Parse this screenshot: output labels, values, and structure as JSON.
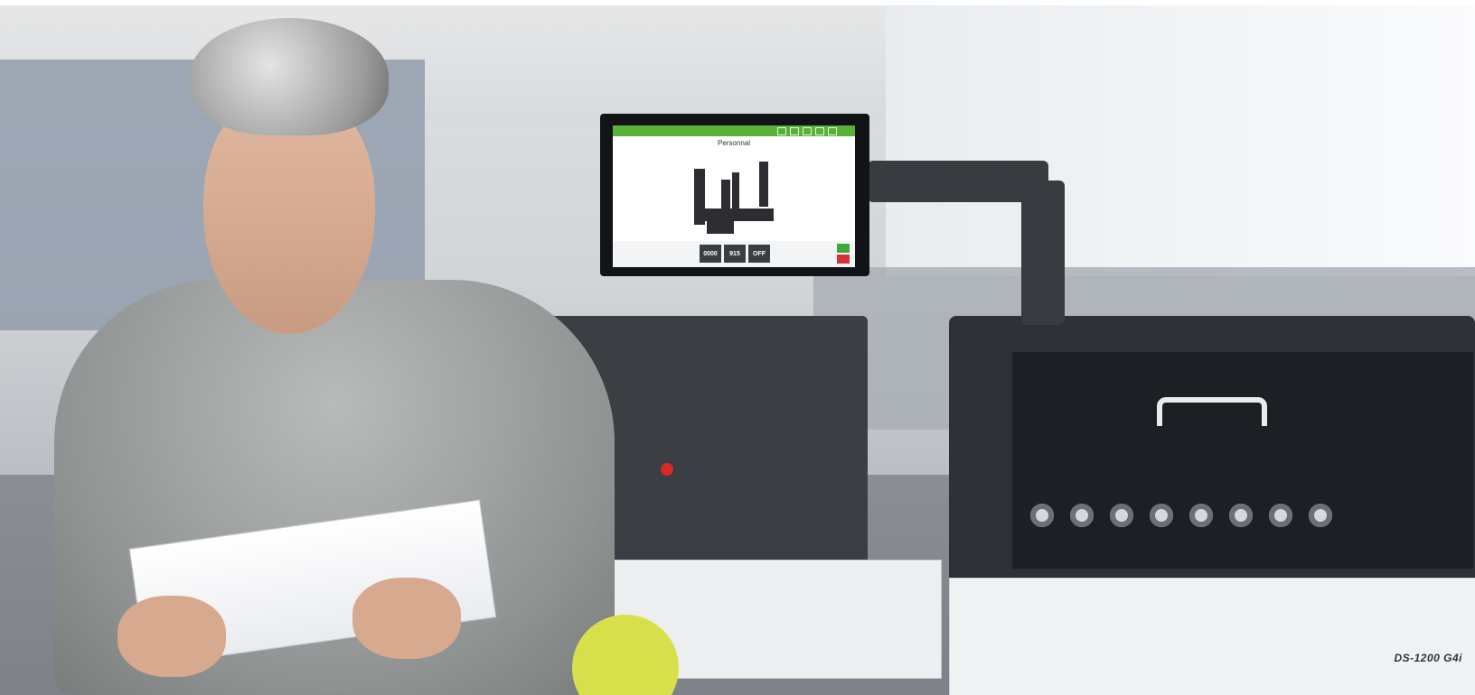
{
  "screen": {
    "title": "Personnal",
    "counters": [
      "0000",
      "915",
      "OFF"
    ]
  },
  "machine": {
    "model_label": "DS-1200 G4i"
  },
  "colors": {
    "screen_bar": "#58b23a",
    "accent_circle": "#d7e04b",
    "start_button": "#3fa83a",
    "stop_button": "#d5313a"
  }
}
